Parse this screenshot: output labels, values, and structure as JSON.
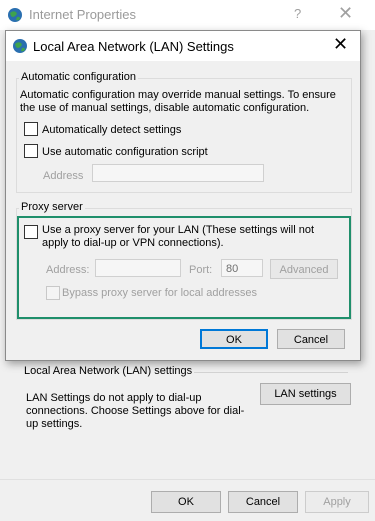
{
  "background_window": {
    "title": "Internet Properties",
    "help_glyph": "?",
    "close_glyph": "✕",
    "lan_group": {
      "title": "Local Area Network (LAN) settings",
      "text": "LAN Settings do not apply to dial-up connections. Choose Settings above for dial-up settings.",
      "button": "LAN settings"
    },
    "buttons": {
      "ok": "OK",
      "cancel": "Cancel",
      "apply": "Apply"
    }
  },
  "dialog": {
    "title": "Local Area Network (LAN) Settings",
    "close_glyph": "✕",
    "auto_config": {
      "title": "Automatic configuration",
      "description": "Automatic configuration may override manual settings.  To ensure the use of manual settings, disable automatic configuration.",
      "detect_label": "Automatically detect settings",
      "detect_checked": false,
      "script_label": "Use automatic configuration script",
      "script_checked": false,
      "address_label": "Address",
      "address_value": ""
    },
    "proxy": {
      "title": "Proxy server",
      "use_proxy_label": "Use a proxy server for your LAN (These settings will not apply to dial-up or VPN connections).",
      "use_proxy_checked": false,
      "address_label": "Address:",
      "address_value": "",
      "port_label": "Port:",
      "port_value": "80",
      "advanced_button": "Advanced",
      "bypass_label": "Bypass proxy server for local addresses",
      "bypass_checked": false
    },
    "buttons": {
      "ok": "OK",
      "cancel": "Cancel"
    },
    "accent_color": "#1f8f6b"
  }
}
